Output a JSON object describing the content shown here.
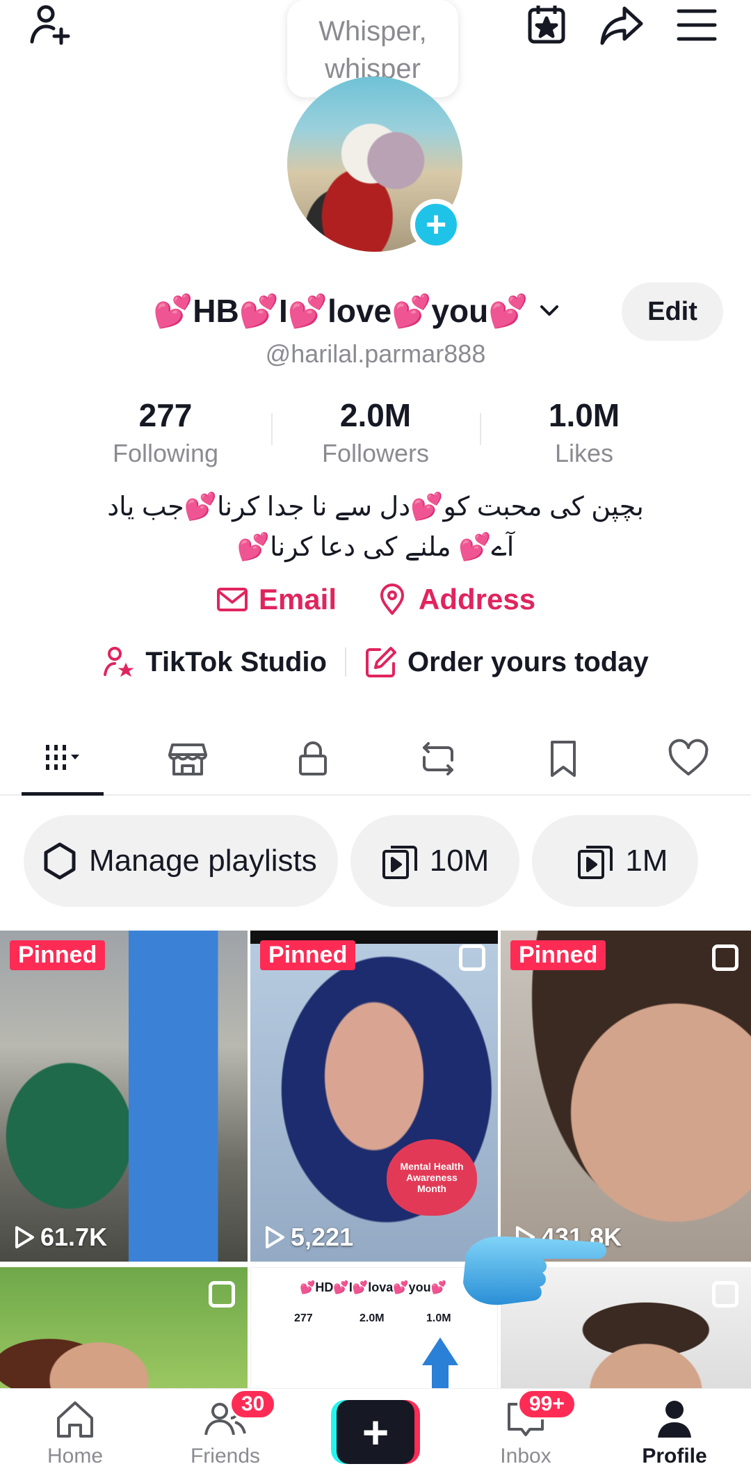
{
  "speech_bubble": "Whisper,\nwhisper",
  "profile": {
    "display_name_parts": [
      "💕",
      "HB",
      "💕",
      "I",
      "💕",
      "love",
      "💕",
      "you",
      "💕"
    ],
    "edit_label": "Edit",
    "handle": "@harilal.parmar888",
    "stats": [
      {
        "value": "277",
        "label": "Following"
      },
      {
        "value": "2.0M",
        "label": "Followers"
      },
      {
        "value": "1.0M",
        "label": "Likes"
      }
    ],
    "bio_line1": "بچپن کی محبت کو💕دل سے نا جدا  کرنا💕جب یاد",
    "bio_line2": "آے💕 ملنے کی دعا کرنا💕",
    "email_label": "Email",
    "address_label": "Address",
    "studio_label": "TikTok Studio",
    "order_label": "Order yours today"
  },
  "chips": [
    {
      "label": "Manage playlists",
      "icon": "gear-outline-icon"
    },
    {
      "label": "10M",
      "icon": "playlist-icon"
    },
    {
      "label": "1M",
      "icon": "playlist-icon"
    }
  ],
  "videos": [
    {
      "pinned": "Pinned",
      "views": "61.7K"
    },
    {
      "pinned": "Pinned",
      "views": "5,221"
    },
    {
      "pinned": "Pinned",
      "views": "431.8K"
    }
  ],
  "thumb_text": {
    "name": "💕HD💕I💕lova💕you💕",
    "stats": [
      "277",
      "2.0M",
      "1.0M"
    ],
    "overlay_label": "Mental Health Awareness Month"
  },
  "nav": {
    "home": "Home",
    "friends": "Friends",
    "friends_badge": "30",
    "inbox": "Inbox",
    "inbox_badge": "99+",
    "profile": "Profile"
  },
  "colors": {
    "accent_pink": "#fe2c55",
    "link_pink": "#e0245e",
    "avatar_add": "#20c3e8",
    "muted_text": "#8a8b91"
  }
}
